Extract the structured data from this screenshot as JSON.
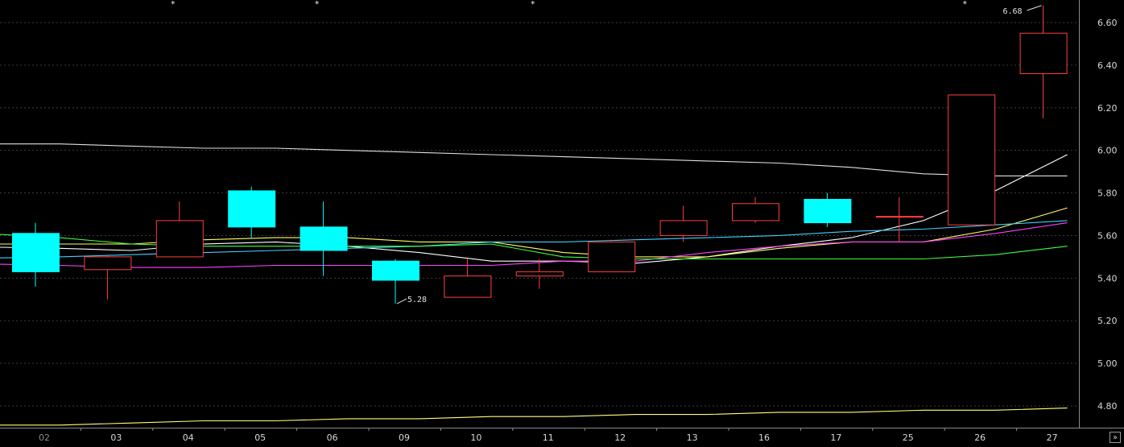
{
  "chart_data": {
    "type": "candlestick",
    "categories": [
      "02",
      "03",
      "04",
      "05",
      "06",
      "09",
      "10",
      "11",
      "12",
      "13",
      "16",
      "17",
      "25",
      "26",
      "27"
    ],
    "candles": [
      {
        "open": 5.43,
        "close": 5.61,
        "high": 5.66,
        "low": 5.36,
        "color": "#00ffff"
      },
      {
        "open": 5.44,
        "close": 5.5,
        "high": 5.51,
        "low": 5.3,
        "color": "#ff4040"
      },
      {
        "open": 5.5,
        "close": 5.67,
        "high": 5.76,
        "low": 5.5,
        "color": "#ff4040"
      },
      {
        "open": 5.64,
        "close": 5.81,
        "high": 5.83,
        "low": 5.59,
        "color": "#00ffff"
      },
      {
        "open": 5.53,
        "close": 5.64,
        "high": 5.76,
        "low": 5.41,
        "color": "#00ffff"
      },
      {
        "open": 5.39,
        "close": 5.48,
        "high": 5.49,
        "low": 5.28,
        "color": "#00ffff"
      },
      {
        "open": 5.31,
        "close": 5.41,
        "high": 5.49,
        "low": 5.31,
        "color": "#ff4040"
      },
      {
        "open": 5.41,
        "close": 5.43,
        "high": 5.49,
        "low": 5.35,
        "color": "#ff4040"
      },
      {
        "open": 5.43,
        "close": 5.57,
        "high": 5.58,
        "low": 5.43,
        "color": "#ff4040"
      },
      {
        "open": 5.6,
        "close": 5.67,
        "high": 5.74,
        "low": 5.57,
        "color": "#ff4040"
      },
      {
        "open": 5.67,
        "close": 5.75,
        "high": 5.78,
        "low": 5.66,
        "color": "#ff4040"
      },
      {
        "open": 5.66,
        "close": 5.77,
        "high": 5.8,
        "low": 5.64,
        "color": "#00ffff"
      },
      {
        "open": 5.69,
        "close": 5.69,
        "high": 5.78,
        "low": 5.57,
        "color": "#ff4040"
      },
      {
        "open": 5.65,
        "close": 6.26,
        "high": 6.26,
        "low": 5.65,
        "color": "#ff4040"
      },
      {
        "open": 6.36,
        "close": 6.55,
        "high": 6.68,
        "low": 6.15,
        "color": "#ff4040"
      }
    ],
    "moving_averages": [
      {
        "color": "#ffffff",
        "values": [
          5.54,
          5.53,
          5.56,
          5.57,
          5.55,
          5.52,
          5.48,
          5.48,
          5.47,
          5.5,
          5.55,
          5.59,
          5.67,
          5.81,
          5.98
        ]
      },
      {
        "color": "#ffff60",
        "values": [
          5.56,
          5.56,
          5.58,
          5.59,
          5.59,
          5.57,
          5.57,
          5.52,
          5.5,
          5.5,
          5.54,
          5.57,
          5.57,
          5.63,
          5.73
        ]
      },
      {
        "color": "#ff40ff",
        "values": [
          5.46,
          5.45,
          5.45,
          5.46,
          5.46,
          5.46,
          5.46,
          5.48,
          5.48,
          5.52,
          5.55,
          5.57,
          5.57,
          5.61,
          5.66
        ]
      },
      {
        "color": "#40d0ff",
        "values": [
          5.5,
          5.51,
          5.52,
          5.53,
          5.54,
          5.55,
          5.57,
          5.57,
          5.58,
          5.59,
          5.6,
          5.62,
          5.63,
          5.65,
          5.67
        ]
      },
      {
        "color": "#40ff40",
        "values": [
          5.59,
          5.56,
          5.55,
          5.55,
          5.55,
          5.55,
          5.56,
          5.5,
          5.49,
          5.49,
          5.49,
          5.49,
          5.49,
          5.51,
          5.55
        ]
      },
      {
        "color": "#e0e0e0",
        "values": [
          6.03,
          6.02,
          6.01,
          6.01,
          6.0,
          5.99,
          5.98,
          5.97,
          5.96,
          5.95,
          5.94,
          5.92,
          5.89,
          5.88,
          5.88
        ]
      },
      {
        "color": "#ffff80",
        "values": [
          4.71,
          4.72,
          4.73,
          4.73,
          4.74,
          4.74,
          4.75,
          4.75,
          4.76,
          4.76,
          4.77,
          4.77,
          4.78,
          4.78,
          4.79
        ]
      }
    ],
    "annotations": [
      {
        "category": "09",
        "value": 5.28,
        "text": "5.28"
      },
      {
        "category": "27",
        "value": 6.68,
        "text": "6.68"
      }
    ],
    "markers": [
      {
        "category": "04",
        "text": "*"
      },
      {
        "category": "06",
        "text": "*"
      },
      {
        "category": "11",
        "text": "*"
      },
      {
        "category": "26",
        "text": "*"
      }
    ],
    "yticks": [
      "6.60",
      "6.40",
      "6.20",
      "6.00",
      "5.80",
      "5.60",
      "5.40",
      "5.20",
      "5.00",
      "4.80"
    ],
    "ylim": [
      4.7,
      6.7
    ],
    "grid": true,
    "colors": {
      "background": "#000000",
      "grid": "#3c3c3c",
      "axis": "#8a8a8a"
    }
  },
  "ui": {
    "expand_button": "»"
  }
}
